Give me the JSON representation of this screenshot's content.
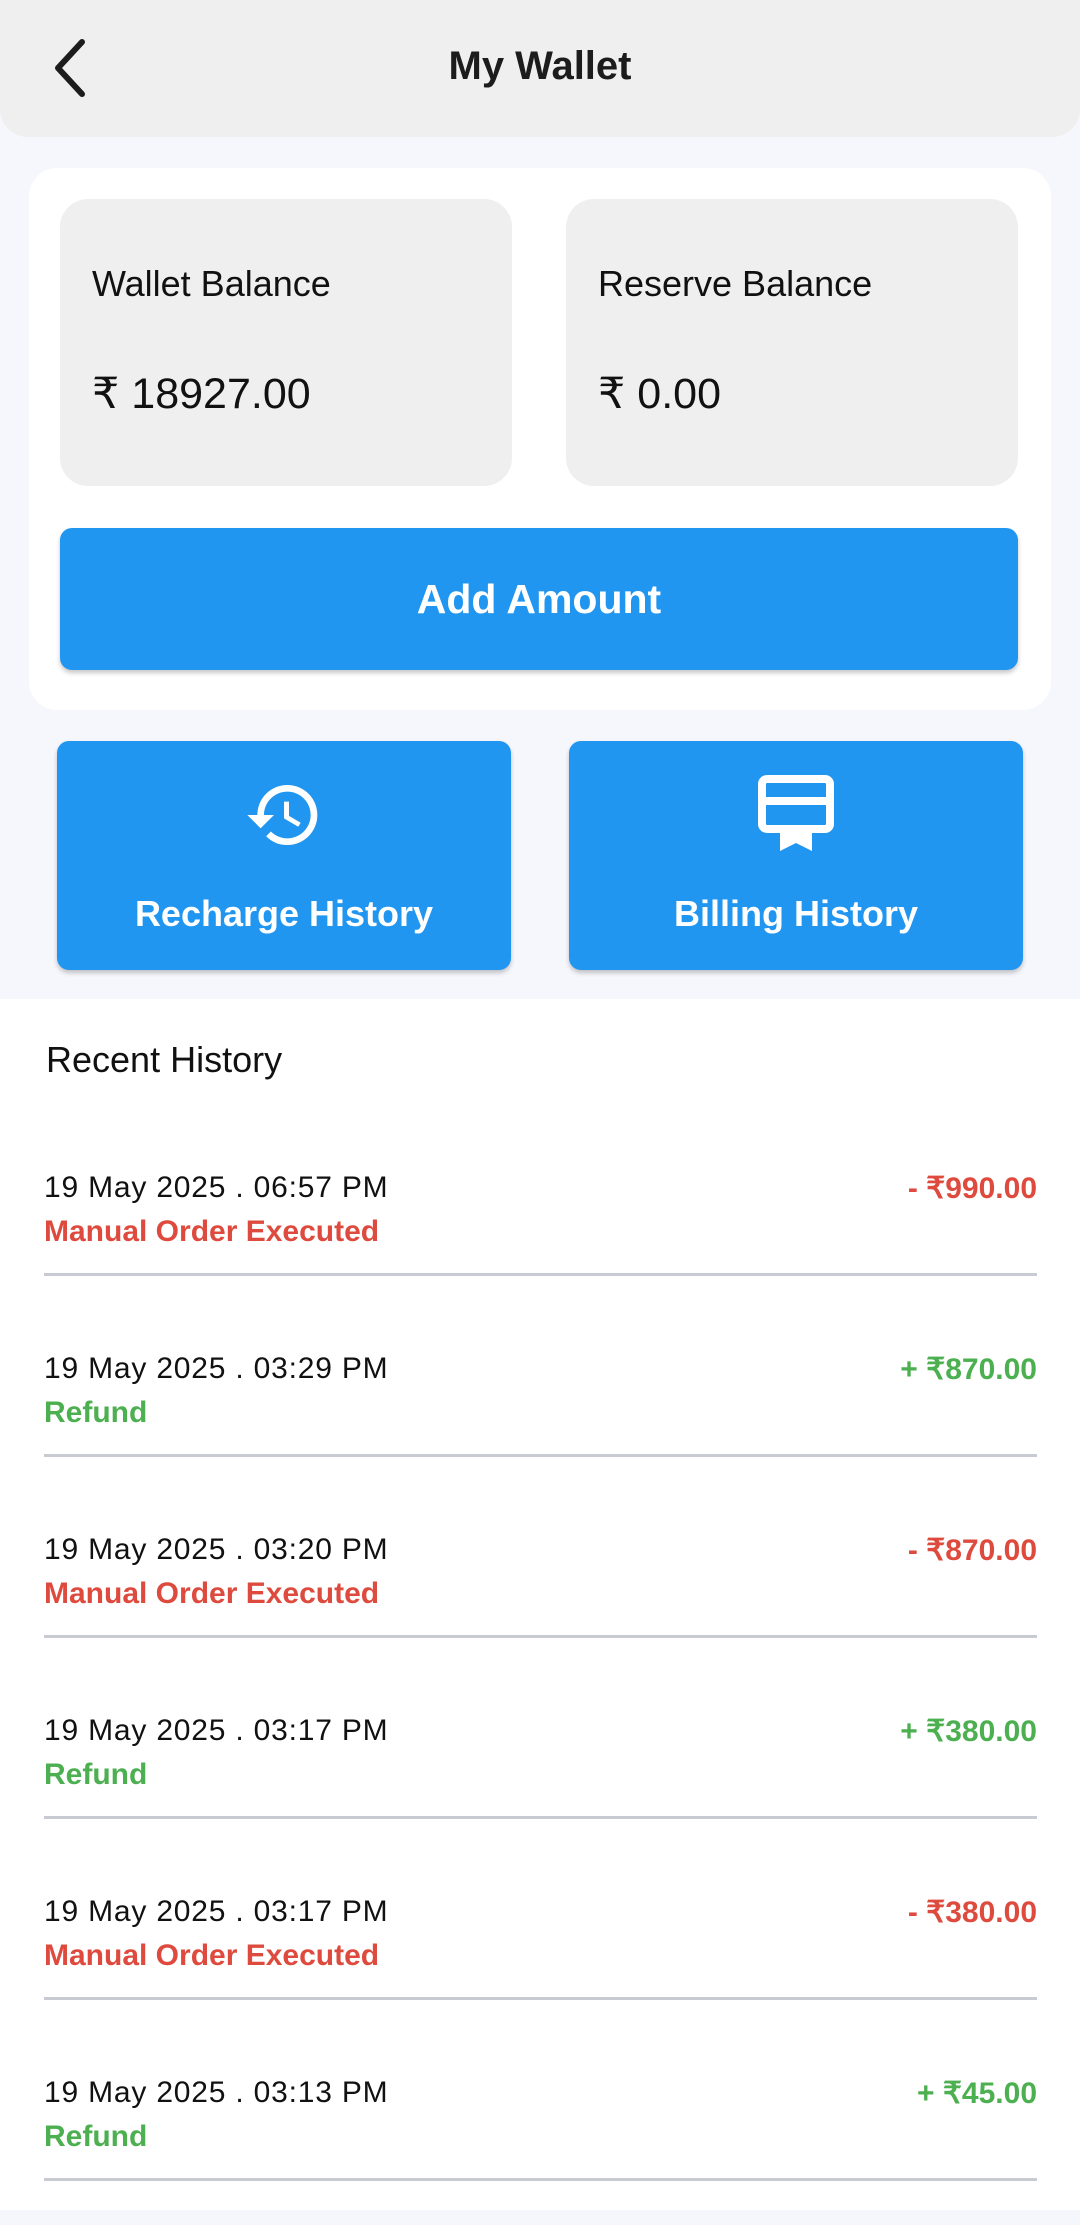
{
  "header": {
    "title": "My Wallet",
    "back_icon": "chevron-left-icon"
  },
  "balances": {
    "wallet": {
      "label": "Wallet Balance",
      "value": "₹ 18927.00"
    },
    "reserve": {
      "label": "Reserve Balance",
      "value": "₹ 0.00"
    }
  },
  "actions": {
    "add_amount_label": "Add Amount",
    "recharge_history": {
      "label": "Recharge History",
      "icon": "history-icon"
    },
    "billing_history": {
      "label": "Billing History",
      "icon": "receipt-icon"
    }
  },
  "history": {
    "title": "Recent History",
    "items": [
      {
        "date": "19 May 2025 . 06:57 PM",
        "description": "Manual Order Executed",
        "amount": "- ₹990.00",
        "type": "debit"
      },
      {
        "date": "19 May 2025 . 03:29 PM",
        "description": "Refund",
        "amount": "+ ₹870.00",
        "type": "credit"
      },
      {
        "date": "19 May 2025 . 03:20 PM",
        "description": "Manual Order Executed",
        "amount": "- ₹870.00",
        "type": "debit"
      },
      {
        "date": "19 May 2025 . 03:17 PM",
        "description": "Refund",
        "amount": "+ ₹380.00",
        "type": "credit"
      },
      {
        "date": "19 May 2025 . 03:17 PM",
        "description": "Manual Order Executed",
        "amount": "- ₹380.00",
        "type": "debit"
      },
      {
        "date": "19 May 2025 . 03:13 PM",
        "description": "Refund",
        "amount": "+ ₹45.00",
        "type": "credit"
      }
    ]
  },
  "colors": {
    "primary": "#2196f0",
    "debit": "#de4b3e",
    "credit": "#4caf50",
    "card_bg": "#efefef",
    "page_bg": "#f6f7fc"
  }
}
